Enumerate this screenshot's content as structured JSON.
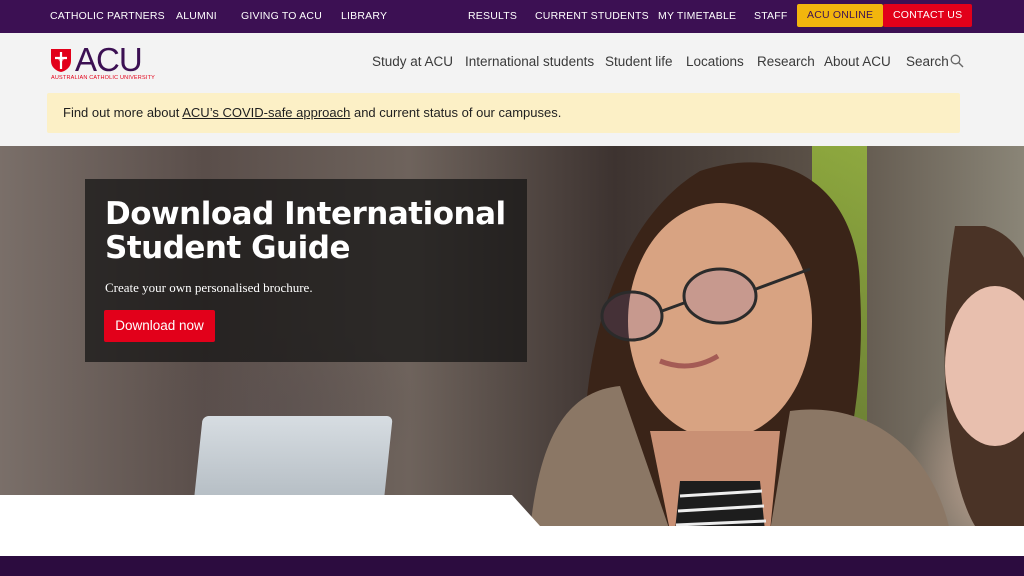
{
  "topbar": {
    "left_links": [
      "CATHOLIC PARTNERS",
      "ALUMNI",
      "GIVING TO ACU",
      "LIBRARY"
    ],
    "right_links": [
      "RESULTS",
      "CURRENT STUDENTS",
      "MY TIMETABLE",
      "STAFF"
    ],
    "acu_online": "ACU ONLINE",
    "contact_us": "CONTACT US"
  },
  "logo": {
    "wordmark": "ACU",
    "subtitle": "AUSTRALIAN CATHOLIC UNIVERSITY"
  },
  "mainnav": {
    "items": [
      "Study at ACU",
      "International students",
      "Student life",
      "Locations",
      "Research",
      "About ACU"
    ],
    "search_label": "Search"
  },
  "covid": {
    "prefix": "Find out more about ",
    "link": "ACU’s COVID-safe approach",
    "suffix": " and current status of our campuses."
  },
  "hero": {
    "title": "Download International Student Guide",
    "subtitle": "Create your own personalised brochure.",
    "cta": "Download now"
  },
  "colors": {
    "brand_purple": "#3c1053",
    "brand_red": "#e2001a",
    "brand_gold": "#f2b50d",
    "alert_bg": "#fcf0c6"
  }
}
